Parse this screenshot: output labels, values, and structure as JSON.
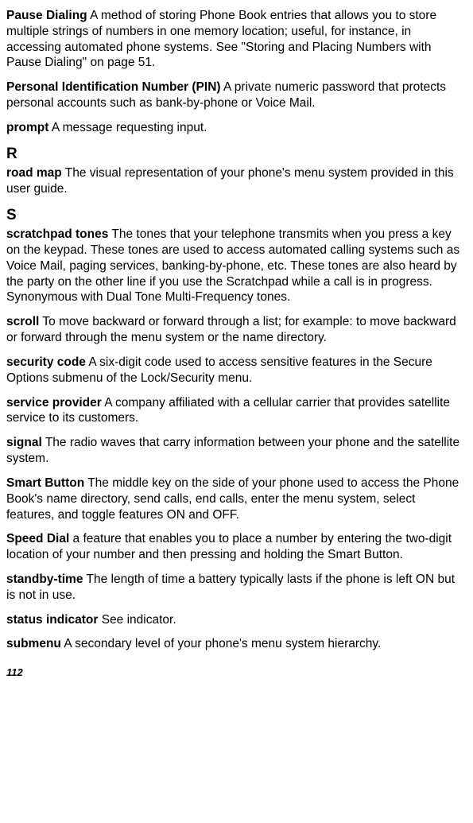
{
  "entries": {
    "pause_dialing": {
      "term": "Pause Dialing",
      "def": "  A method of storing Phone Book entries that allows you to store multiple strings of numbers in one memory location; useful, for instance, in accessing automated phone systems. See \"Storing and Placing Numbers with Pause Dialing\" on page 51."
    },
    "pin": {
      "term": "Personal Identification Number (PIN)",
      "def": "  A private numeric password that protects personal accounts such as bank-by-phone or Voice Mail."
    },
    "prompt": {
      "term": "prompt",
      "def": "  A message requesting input."
    },
    "road_map": {
      "term": "road map",
      "def": "  The visual representation of your phone's menu system provided in this user guide."
    },
    "scratchpad_tones": {
      "term": "scratchpad tones",
      "def": "   The tones that your telephone transmits when you press a key on the keypad. These tones are used to access automated calling systems such as Voice Mail, paging services, banking-by-phone, etc. These tones are also heard by the party on the other line if you use the Scratchpad while a call is in progress. Synonymous with Dual Tone Multi-Frequency tones."
    },
    "scroll": {
      "term": "scroll",
      "def": "  To move backward or forward through a list; for example: to move backward or forward through the menu system or the name directory."
    },
    "security_code": {
      "term": "security code",
      "def": "  A six-digit code used to access sensitive features in the Secure Options submenu of the Lock/Security menu."
    },
    "service_provider": {
      "term": "service provider",
      "def": "   A company affiliated with a cellular carrier that provides satellite service to its customers."
    },
    "signal": {
      "term": "signal",
      "def": "  The radio waves that carry information between your phone and the satellite system."
    },
    "smart_button": {
      "term": "Smart Button",
      "def": "   The middle key on the side of your phone used to access the Phone Book's name directory, send calls, end calls, enter the menu system, select features, and toggle features ON and OFF."
    },
    "speed_dial": {
      "term": "Speed Dial",
      "def": "   a feature that enables you to place a number by entering the two-digit location of your number and then pressing and holding the Smart Button."
    },
    "standby_time": {
      "term": "standby-time",
      "def": "   The length of time a battery typically lasts if the phone is left ON but is not in use."
    },
    "status_indicator": {
      "term": "status indicator",
      "def": "  See indicator."
    },
    "submenu": {
      "term": "submenu",
      "def": "  A secondary level of your phone's menu system hierarchy."
    }
  },
  "sections": {
    "r": "R",
    "s": "S"
  },
  "page_number": "112"
}
